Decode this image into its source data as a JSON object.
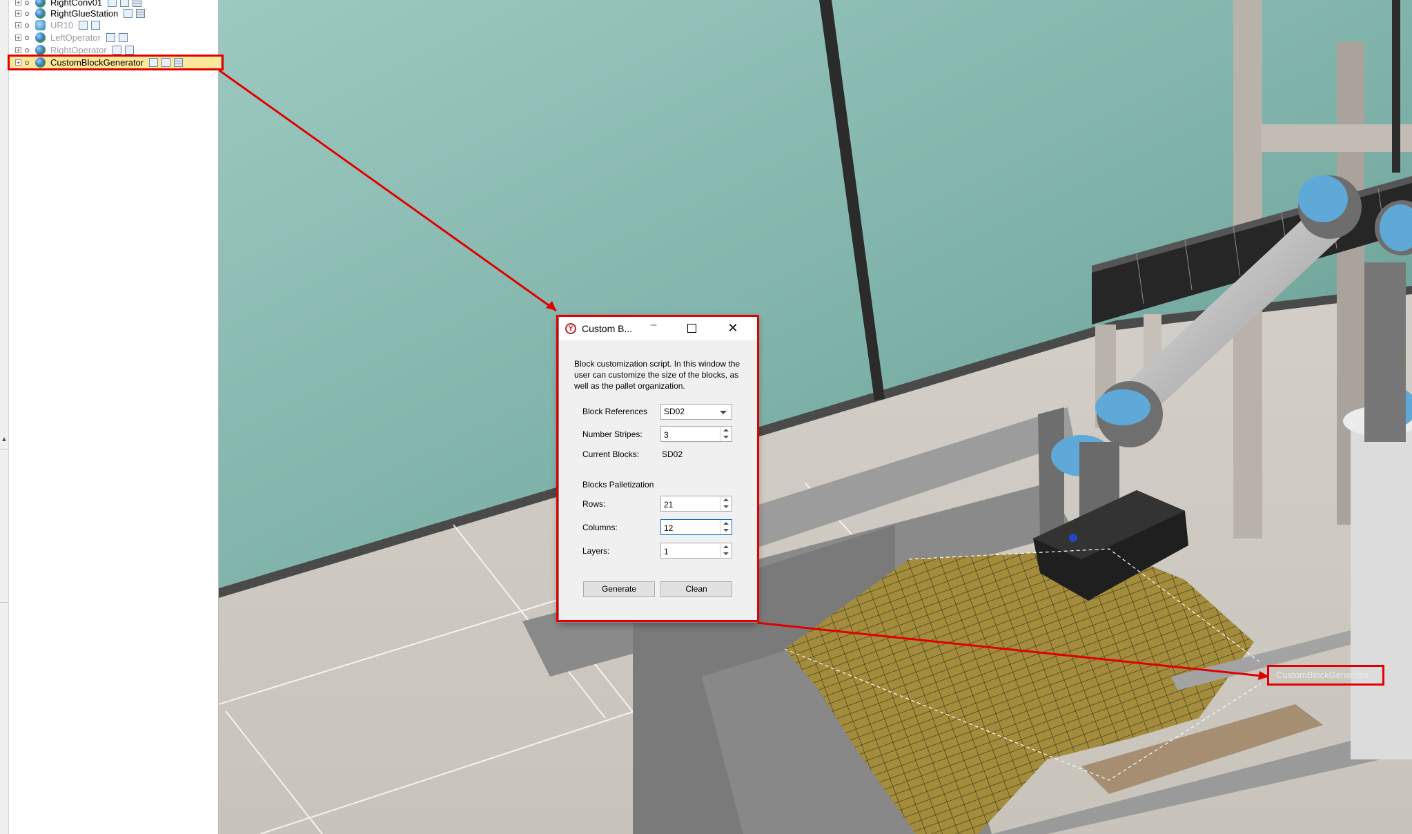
{
  "tree": {
    "items": [
      {
        "label": "RightConv01",
        "dim": false
      },
      {
        "label": "RightGlueStation",
        "dim": false
      },
      {
        "label": "UR10",
        "dim": true
      },
      {
        "label": "LeftOperator",
        "dim": true
      },
      {
        "label": "RightOperator",
        "dim": true
      },
      {
        "label": "CustomBlockGenerator",
        "dim": false,
        "selected": true
      }
    ]
  },
  "dialog": {
    "title": "Custom B...",
    "description": "Block customization script. In this window the user can customize the size of the blocks, as well as the pallet organization.",
    "block_references_label": "Block References",
    "block_references_value": "SD02",
    "number_stripes_label": "Number Stripes:",
    "number_stripes_value": "3",
    "current_blocks_label": "Current Blocks:",
    "current_blocks_value": "SD02",
    "palletization_heading": "Blocks Palletization",
    "rows_label": "Rows:",
    "rows_value": "21",
    "columns_label": "Columns:",
    "columns_value": "12",
    "layers_label": "Layers:",
    "layers_value": "1",
    "generate_label": "Generate",
    "clean_label": "Clean"
  },
  "viewport": {
    "object_label": "CustomBlockGenerator"
  },
  "colors": {
    "callout": "#e00000",
    "selection": "#fde79a",
    "wall": "#7fb4ab",
    "floor": "#cfcac2",
    "blocks": "#a08a3a",
    "robot_joint": "#5ea9d8"
  }
}
